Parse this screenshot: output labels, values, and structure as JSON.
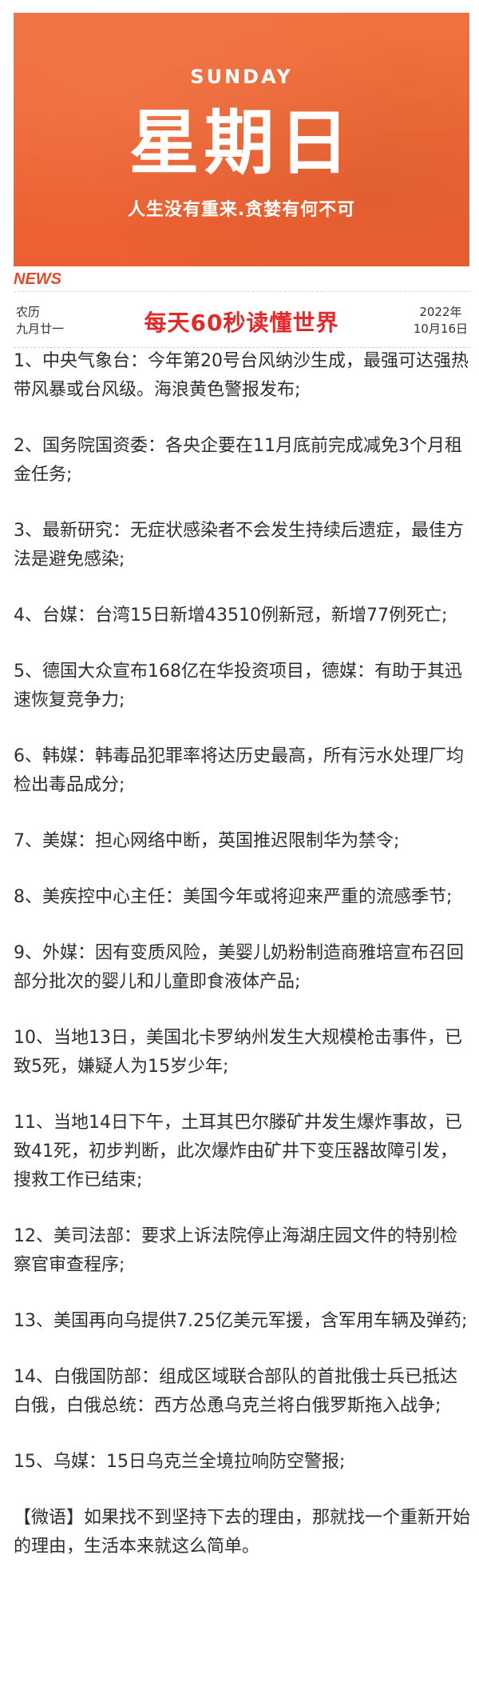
{
  "banner": {
    "day_en": "SUNDAY",
    "day_cn": "星期日",
    "motto": "人生没有重来.贪婪有何不可",
    "colors": {
      "background": "#ef6837",
      "text": "#ffffff"
    }
  },
  "news_label": "NEWS",
  "header": {
    "lunar_label": "农历",
    "lunar_date": "九月廿一",
    "title": "每天60秒读懂世界",
    "year": "2022年",
    "date": "10月16日",
    "title_color": "#e22a2a"
  },
  "items": [
    "1、中央气象台：今年第20号台风纳沙生成，最强可达强热带风暴或台风级。海浪黄色警报发布;",
    "2、国务院国资委：各央企要在11月底前完成减免3个月租金任务;",
    "3、最新研究：无症状感染者不会发生持续后遗症，最佳方法是避免感染;",
    "4、台媒：台湾15日新增43510例新冠，新增77例死亡;",
    "5、德国大众宣布168亿在华投资项目，德媒：有助于其迅速恢复竞争力;",
    "6、韩媒：韩毒品犯罪率将达历史最高，所有污水处理厂均检出毒品成分;",
    "7、美媒：担心网络中断，英国推迟限制华为禁令;",
    "8、美疾控中心主任：美国今年或将迎来严重的流感季节;",
    "9、外媒：因有变质风险，美婴儿奶粉制造商雅培宣布召回部分批次的婴儿和儿童即食液体产品;",
    "10、当地13日，美国北卡罗纳州发生大规模枪击事件，已致5死，嫌疑人为15岁少年;",
    "11、当地14日下午，土耳其巴尔滕矿井发生爆炸事故，已致41死，初步判断，此次爆炸由矿井下变压器故障引发，搜救工作已结束;",
    "12、美司法部：要求上诉法院停止海湖庄园文件的特别检察官审查程序;",
    "13、美国再向乌提供7.25亿美元军援，含军用车辆及弹药;",
    "14、白俄国防部：组成区域联合部队的首批俄士兵已抵达白俄，白俄总统：西方怂恿乌克兰将白俄罗斯拖入战争;",
    "15、乌媒：15日乌克兰全境拉响防空警报;"
  ],
  "quote": "【微语】如果找不到坚持下去的理由，那就找一个重新开始的理由，生活本来就这么简单。"
}
